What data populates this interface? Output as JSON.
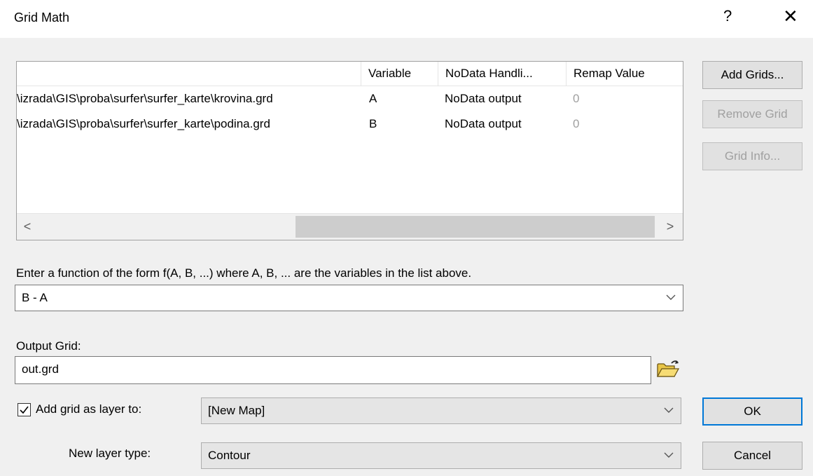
{
  "window": {
    "title": "Grid Math",
    "help": "?",
    "close": "✕"
  },
  "grid_list": {
    "columns": [
      "",
      "Variable",
      "NoData Handli...",
      "Remap Value"
    ],
    "rows": [
      {
        "path": "\\izrada\\GIS\\proba\\surfer\\surfer_karte\\krovina.grd",
        "variable": "A",
        "nodata": "NoData output",
        "remap": "0"
      },
      {
        "path": "\\izrada\\GIS\\proba\\surfer\\surfer_karte\\podina.grd",
        "variable": "B",
        "nodata": "NoData output",
        "remap": "0"
      }
    ],
    "scroll_left": "<",
    "scroll_right": ">"
  },
  "buttons": {
    "add_grids": "Add Grids...",
    "remove_grid": "Remove Grid",
    "grid_info": "Grid Info...",
    "ok": "OK",
    "cancel": "Cancel"
  },
  "function": {
    "prompt": "Enter a function of the form f(A, B, ...) where A, B, ... are the variables in the list above.",
    "value": "B - A"
  },
  "output": {
    "label": "Output Grid:",
    "value": "out.grd"
  },
  "add_layer": {
    "label": "Add grid as layer to:",
    "checked": true,
    "value": "[New Map]"
  },
  "layer_type": {
    "label": "New layer type:",
    "value": "Contour"
  },
  "colors": {
    "accent": "#0078d7",
    "disabled_text": "#a0a0a0"
  }
}
